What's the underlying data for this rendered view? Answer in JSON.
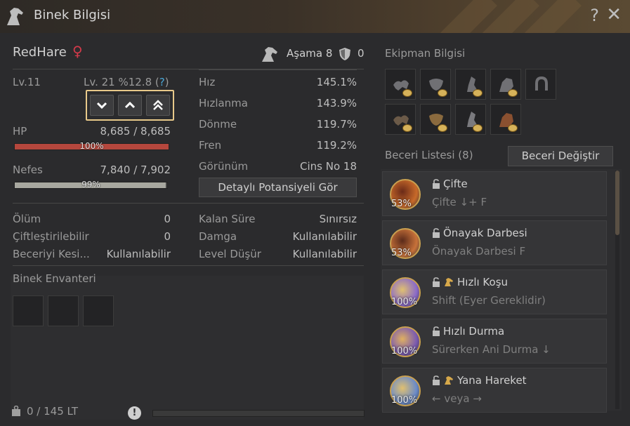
{
  "window": {
    "title": "Binek Bilgisi",
    "help_label": "?",
    "close_label": "✕"
  },
  "horse": {
    "name": "RedHare",
    "gender_icon": "female-icon",
    "stage_label": "Aşama 8",
    "shield_value": "0"
  },
  "level": {
    "level_label": "Lv.11",
    "exp_label": "Lv. 21 %12.8 (",
    "exp_help": "?",
    "exp_close": ")"
  },
  "stats_left": {
    "hp_label": "HP",
    "hp_value": "8,685 / 8,685",
    "hp_pct": "100%",
    "hp_fill": 1.0,
    "stamina_label": "Nefes",
    "stamina_value": "7,840 / 7,902",
    "stamina_pct": "99%",
    "stamina_fill": 0.99
  },
  "stats_right": [
    {
      "label": "Hız",
      "value": "145.1%"
    },
    {
      "label": "Hızlanma",
      "value": "143.9%"
    },
    {
      "label": "Dönme",
      "value": "119.7%"
    },
    {
      "label": "Fren",
      "value": "119.2%"
    },
    {
      "label": "Görünüm",
      "value": "Cins No 18"
    }
  ],
  "potential_button": "Detaylı Potansiyeli Gör",
  "info_left": [
    {
      "label": "Ölüm",
      "value": "0"
    },
    {
      "label": "Çiftleştirilebilir",
      "value": "0"
    },
    {
      "label": "Beceriyi Kesi...",
      "value": "Kullanılabilir"
    }
  ],
  "info_right": [
    {
      "label": "Kalan Süre",
      "value": "Sınırsız"
    },
    {
      "label": "Damga",
      "value": "Kullanılabilir"
    },
    {
      "label": "Level Düşür",
      "value": "Kullanılabilir"
    }
  ],
  "inventory": {
    "title": "Binek Envanteri",
    "weight": "0 / 145 LT",
    "warning_icon": "!"
  },
  "equipment": {
    "title": "Ekipman Bilgisi"
  },
  "skills": {
    "title": "Beceri Listesi (8)",
    "change_button": "Beceri Değiştir",
    "items": [
      {
        "name": "Çifte",
        "desc": "Çifte ↓+ F",
        "pct": "53%",
        "horse": false
      },
      {
        "name": "Önayak Darbesi",
        "desc": "Önayak Darbesi F",
        "pct": "53%",
        "horse": false
      },
      {
        "name": "Hızlı Koşu",
        "desc": "Shift (Eyer Gereklidir)",
        "pct": "100%",
        "horse": true
      },
      {
        "name": "Hızlı Durma",
        "desc": "Sürerken Ani Durma ↓",
        "pct": "100%",
        "horse": false
      },
      {
        "name": "Yana Hareket",
        "desc": "← veya →",
        "pct": "100%",
        "horse": true
      }
    ]
  },
  "colors": {
    "hp_bar": "#b5473d",
    "stamina_bar": "#a8a8a0",
    "accent_frame": "#e8c98a",
    "female": "#d23a4a"
  }
}
